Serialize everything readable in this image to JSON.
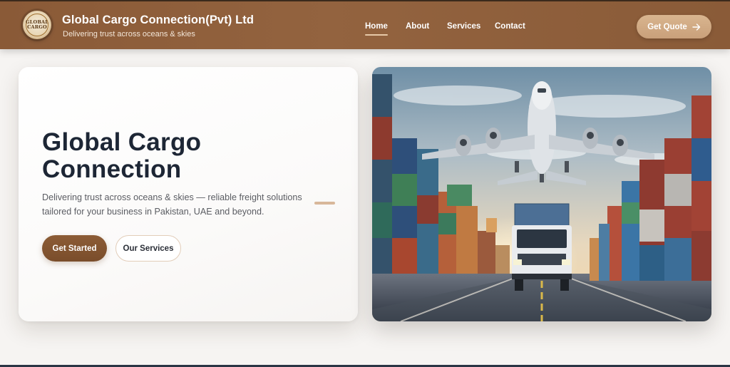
{
  "header": {
    "logo_text_line1": "GLOBAL",
    "logo_text_line2": "CARGO",
    "brand_title": "Global Cargo Connection(Pvt) Ltd",
    "brand_tagline": "Delivering trust across oceans & skies",
    "nav": [
      {
        "label": "Home",
        "active": true
      },
      {
        "label": "About",
        "active": false
      },
      {
        "label": "Services",
        "active": false
      },
      {
        "label": "Contact",
        "active": false
      }
    ],
    "quote_button": "Get Quote",
    "quote_icon": "arrow-right-icon"
  },
  "hero": {
    "title": "Global Cargo Connection",
    "description": "Delivering trust across oceans & skies — reliable freight solutions tailored for your business in Pakistan, UAE and beyond.",
    "primary_button": "Get Started",
    "secondary_button": "Our Services",
    "image_subject": "cargo-plane-truck-containers"
  },
  "colors": {
    "header_brown": "#8a5a37",
    "accent_tan": "#d9b58f",
    "primary_button": "#7a4d2b",
    "title_navy": "#1d2635"
  }
}
